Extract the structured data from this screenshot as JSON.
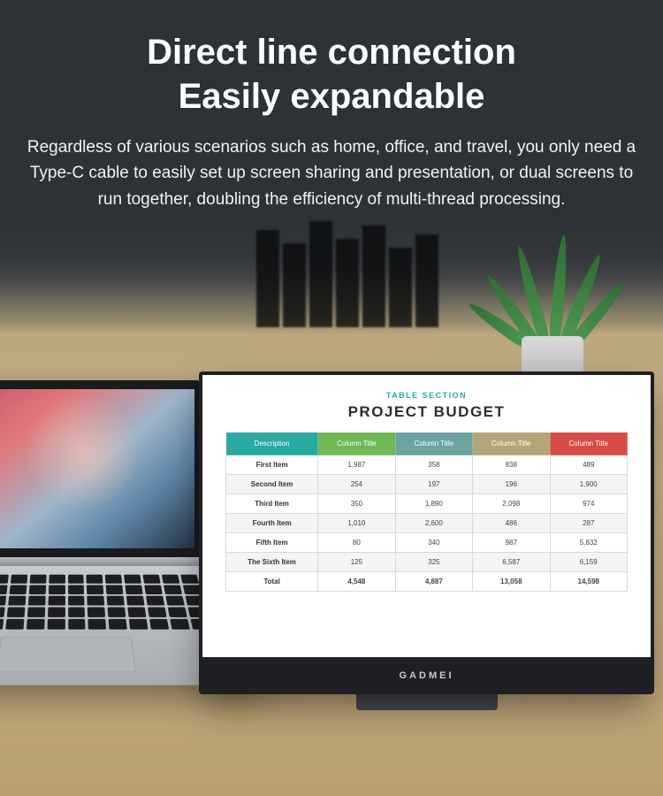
{
  "hero": {
    "title_line1": "Direct line connection",
    "title_line2": "Easily expandable",
    "body": "Regardless of various scenarios such as home, office, and travel, you only need a Type-C cable to easily set up screen sharing and presentation, or dual screens to run together, doubling the efficiency of multi-thread processing."
  },
  "monitor": {
    "brand": "GADMEI",
    "sheet": {
      "section_label": "TABLE SECTION",
      "title": "PROJECT BUDGET",
      "headers": [
        "Description",
        "Column Title",
        "Column Title",
        "Column Title",
        "Column Title"
      ],
      "rows": [
        [
          "First Item",
          "1,987",
          "358",
          "838",
          "489"
        ],
        [
          "Second Item",
          "254",
          "197",
          "196",
          "1,900"
        ],
        [
          "Third Item",
          "350",
          "1,890",
          "2,098",
          "974"
        ],
        [
          "Fourth Item",
          "1,010",
          "2,600",
          "486",
          "287"
        ],
        [
          "Fifth Item",
          "80",
          "340",
          "987",
          "5,832"
        ],
        [
          "The Sixth Item",
          "125",
          "325",
          "6,587",
          "6,159"
        ],
        [
          "Total",
          "4,548",
          "4,887",
          "13,058",
          "14,598"
        ]
      ]
    }
  }
}
